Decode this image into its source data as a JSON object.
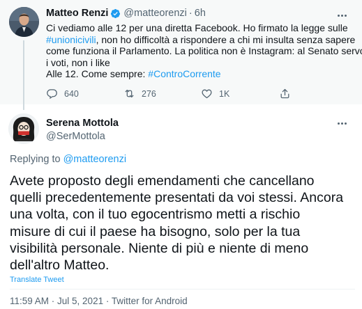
{
  "parent_tweet": {
    "author_name": "Matteo Renzi",
    "handle": "@matteorenzi",
    "separator": "·",
    "time": "6h",
    "text_lines": [
      [
        "Ci vediamo alle 12 per una diretta Facebook. Ho firmato la legge sulle"
      ],
      [
        "#unionicivili",
        ", non ho difficoltà a rispondere a chi mi insulta senza sapere"
      ],
      [
        "come funziona il Parlamento. La politica non è Instagram: al Senato servono"
      ],
      [
        "i voti, non i like"
      ],
      [
        "Alle 12. Come sempre: ",
        "#ControCorrente"
      ]
    ],
    "reply_count": "640",
    "retweet_count": "276",
    "like_count": "1K"
  },
  "reply_tweet": {
    "author_name": "Serena Mottola",
    "handle": "@SerMottola",
    "replying_label": "Replying to",
    "replying_to": "@matteorenzi",
    "text_lines": [
      "Avete proposto degli emendamenti che cancellano",
      "quelli precedentemente presentati da voi stessi. Ancora",
      "una volta, con il tuo egocentrismo metti a rischio",
      "misure di cui il paese ha bisogno, solo per la tua",
      "visibilità personale. Niente di più e niente di meno",
      "dell'altro Matteo."
    ],
    "translate_label": "Translate Tweet",
    "meta": "11:59 AM · Jul 5, 2021 · Twitter for Android"
  },
  "colors": {
    "link": "#1d9bf0",
    "secondary_text": "#536471",
    "parent_background": "#f7f9f9",
    "thread_line": "#cfd9de"
  },
  "icons": {
    "verified": "verified-badge-icon",
    "more": "more-options-icon",
    "reply": "reply-icon",
    "retweet": "retweet-icon",
    "like": "like-icon",
    "share": "share-icon"
  }
}
